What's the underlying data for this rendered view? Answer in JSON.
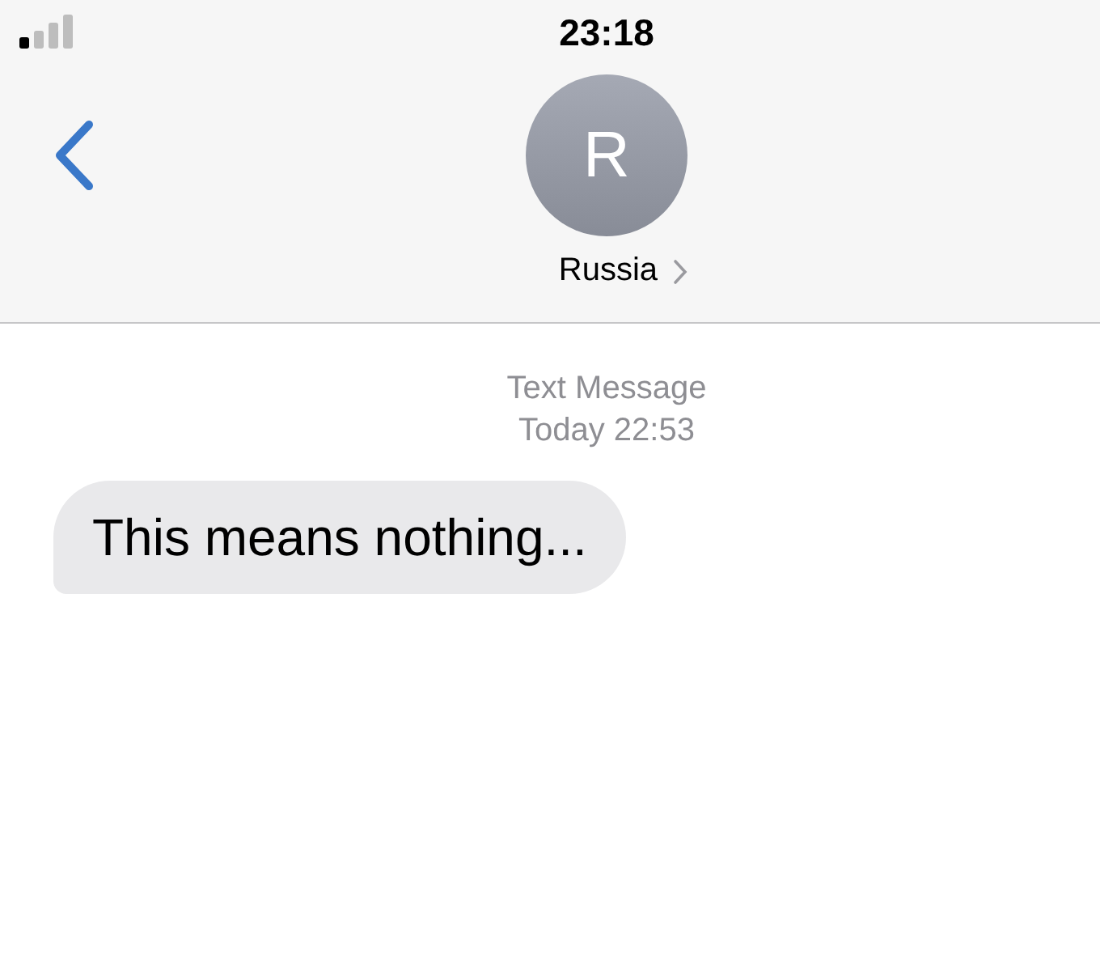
{
  "status_bar": {
    "time": "23:18"
  },
  "contact": {
    "initial": "R",
    "name": "Russia"
  },
  "timestamp": {
    "service": "Text Message",
    "time": "Today 22:53"
  },
  "messages": [
    {
      "kind": "received",
      "text": "This means nothing..."
    }
  ]
}
